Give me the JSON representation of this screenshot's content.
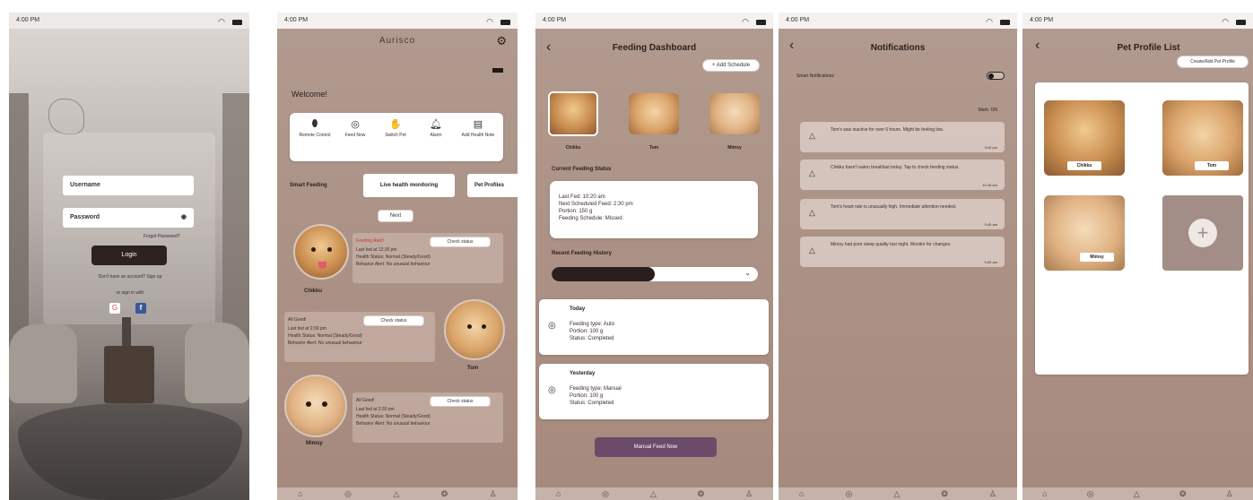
{
  "screens": {
    "login": {
      "status_time": "4:00 PM",
      "username_placeholder": "Username",
      "password_placeholder": "Password",
      "forgot": "Forgot Password?",
      "login_button": "Login",
      "signup_text": "Don't have an account? Sign up",
      "or_text": "or sign in with"
    },
    "home": {
      "status_time": "4:00 PM",
      "app_name": "Aurisco",
      "welcome": "Welcome!",
      "actions": [
        {
          "label": "Remote Control",
          "icon": "bottle-icon"
        },
        {
          "label": "Feed Now",
          "icon": "bowl-icon"
        },
        {
          "label": "Switch Pet",
          "icon": "paw-icon"
        },
        {
          "label": "Alarm",
          "icon": "bell-icon"
        },
        {
          "label": "Add Health Note",
          "icon": "note-icon"
        }
      ],
      "tabs": [
        "Smart Feeding",
        "Live health monitoring",
        "Pet Profiles"
      ],
      "next_button": "Next",
      "pets": [
        {
          "name": "Chikku",
          "alert": "Feeding Alert!",
          "lines": [
            "Last fed at 12:30 pm",
            "Health Status: Normal (Steady/Good)",
            "Behavior Alert: No unusual behaviour"
          ],
          "button": "Check status"
        },
        {
          "name": "Tom",
          "alert": "All Good!",
          "lines": [
            "Last fed at 2:00 pm",
            "Health Status: Normal (Steady/Good)",
            "Behavior Alert: No unusual behaviour"
          ],
          "button": "Check status"
        },
        {
          "name": "Mimsy",
          "alert": "All Good!",
          "lines": [
            "Last fed at 2:30 pm",
            "Health Status: Normal (Steady/Good)",
            "Behavior Alert: No unusual behaviour"
          ],
          "button": "Check status"
        }
      ]
    },
    "dashboard": {
      "status_time": "4:00 PM",
      "title": "Feeding Dashboard",
      "add_schedule": "+ Add Schedule",
      "pets": [
        "Chikku",
        "Tom",
        "Mimsy"
      ],
      "current_heading": "Current Feeding Status",
      "current_lines": [
        "Last Fed: 10:20 am",
        "Next Scheduled Feed: 2:30 pm",
        "Portion: 150 g",
        "Feeding Schedule: Missed"
      ],
      "history_heading": "Recent Feeding History",
      "history_progress": 0.5,
      "entries": [
        {
          "day": "Today",
          "lines": [
            "Feeding type: Auto",
            "Portion: 100 g",
            "Status: Completed"
          ]
        },
        {
          "day": "Yesterday",
          "lines": [
            "Feeding type: Manual",
            "Portion: 100 g",
            "Status: Completed"
          ]
        }
      ],
      "manual_button": "Manual Feed Now"
    },
    "notifications": {
      "status_time": "4:00 PM",
      "title": "Notifications",
      "smart_label": "Smart Notifications",
      "mark_all": "Mark: ON",
      "items": [
        {
          "text": "Tom's was inactive for over 6 hours. Might be feeling low.",
          "time": "3:45 pm"
        },
        {
          "text": "Chikku hasn't eaten breakfast today. Tap to check feeding status.",
          "time": "10:45 am"
        },
        {
          "text": "Tom's heart rate is unusually high. Immediate attention needed.",
          "time": "9:45 am"
        },
        {
          "text": "Mimsy had poor sleep quality last night. Monitor for changes.",
          "time": "9:45 am"
        }
      ]
    },
    "profiles": {
      "status_time": "4:00 PM",
      "title": "Pet Profile List",
      "create_button": "Create/Add Pet Profile",
      "pets": [
        "Chikku",
        "Tom",
        "Mimsy"
      ]
    }
  },
  "colors": {
    "screen_bg": "#a99084",
    "dark_button": "#2d2220",
    "purple_button": "#6b4a6a"
  }
}
